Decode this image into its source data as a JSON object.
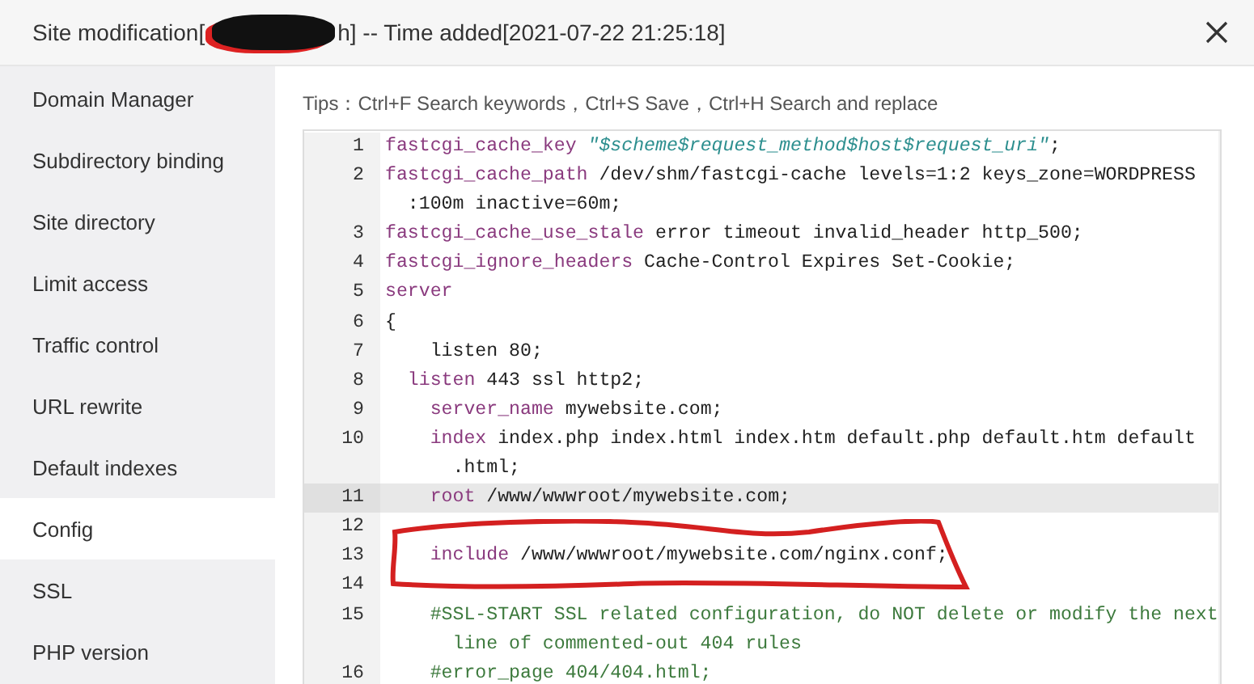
{
  "dialog": {
    "title_start": "Site modification[",
    "title_redacted": true,
    "title_end": "h] -- Time added[2021-07-22 21:25:18]"
  },
  "sidebar": {
    "items": [
      {
        "label": "Domain Manager",
        "selected": false
      },
      {
        "label": "Subdirectory binding",
        "selected": false
      },
      {
        "label": "Site directory",
        "selected": false
      },
      {
        "label": "Limit access",
        "selected": false
      },
      {
        "label": "Traffic control",
        "selected": false
      },
      {
        "label": "URL rewrite",
        "selected": false
      },
      {
        "label": "Default indexes",
        "selected": false
      },
      {
        "label": "Config",
        "selected": true
      },
      {
        "label": "SSL",
        "selected": false
      },
      {
        "label": "PHP version",
        "selected": false
      }
    ]
  },
  "tips": "Tips：Ctrl+F Search keywords，Ctrl+S Save，Ctrl+H Search and replace",
  "editor": {
    "lines": [
      {
        "number": "1",
        "active": false,
        "rows": [
          [
            {
              "kind": "keyword",
              "text": "fastcgi_cache_key"
            },
            {
              "kind": "plain",
              "text": " "
            },
            {
              "kind": "string",
              "text": "\"$scheme$request_method$host$request_uri\""
            },
            {
              "kind": "plain",
              "text": ";"
            }
          ]
        ]
      },
      {
        "number": "2",
        "active": false,
        "rows": [
          [
            {
              "kind": "keyword",
              "text": "fastcgi_cache_path"
            },
            {
              "kind": "plain",
              "text": " /dev/shm/fastcgi-cache levels=1:2 keys_zone=WORDPRESS"
            }
          ],
          [
            {
              "kind": "plain",
              "text": "  :100m inactive=60m;"
            }
          ]
        ]
      },
      {
        "number": "3",
        "active": false,
        "rows": [
          [
            {
              "kind": "keyword",
              "text": "fastcgi_cache_use_stale"
            },
            {
              "kind": "plain",
              "text": " error timeout invalid_header http_500;"
            }
          ]
        ]
      },
      {
        "number": "4",
        "active": false,
        "rows": [
          [
            {
              "kind": "keyword",
              "text": "fastcgi_ignore_headers"
            },
            {
              "kind": "plain",
              "text": " Cache-Control Expires Set-Cookie;"
            }
          ]
        ]
      },
      {
        "number": "5",
        "active": false,
        "rows": [
          [
            {
              "kind": "keyword",
              "text": "server"
            }
          ]
        ]
      },
      {
        "number": "6",
        "active": false,
        "rows": [
          [
            {
              "kind": "plain",
              "text": "{"
            }
          ]
        ]
      },
      {
        "number": "7",
        "active": false,
        "rows": [
          [
            {
              "kind": "plain",
              "text": "    listen 80;"
            }
          ]
        ]
      },
      {
        "number": "8",
        "active": false,
        "rows": [
          [
            {
              "kind": "keyword",
              "text": "  listen"
            },
            {
              "kind": "plain",
              "text": " 443 ssl http2;"
            }
          ]
        ]
      },
      {
        "number": "9",
        "active": false,
        "rows": [
          [
            {
              "kind": "keyword",
              "text": "    server_name"
            },
            {
              "kind": "plain",
              "text": " mywebsite.com;"
            }
          ]
        ]
      },
      {
        "number": "10",
        "active": false,
        "rows": [
          [
            {
              "kind": "keyword",
              "text": "    index"
            },
            {
              "kind": "plain",
              "text": " index.php index.html index.htm default.php default.htm default"
            }
          ],
          [
            {
              "kind": "plain",
              "text": "      .html;"
            }
          ]
        ]
      },
      {
        "number": "11",
        "active": true,
        "rows": [
          [
            {
              "kind": "keyword",
              "text": "    root"
            },
            {
              "kind": "plain",
              "text": " /www/wwwroot/mywebsite.com;"
            }
          ]
        ]
      },
      {
        "number": "12",
        "active": false,
        "rows": [
          [
            {
              "kind": "plain",
              "text": " "
            }
          ]
        ]
      },
      {
        "number": "13",
        "active": false,
        "rows": [
          [
            {
              "kind": "keyword",
              "text": "    include"
            },
            {
              "kind": "plain",
              "text": " /www/wwwroot/mywebsite.com/nginx.conf;"
            }
          ]
        ]
      },
      {
        "number": "14",
        "active": false,
        "rows": [
          [
            {
              "kind": "plain",
              "text": " "
            }
          ]
        ]
      },
      {
        "number": "15",
        "active": false,
        "rows": [
          [
            {
              "kind": "comment",
              "text": "    #SSL-START SSL related configuration, do NOT delete or modify the next"
            }
          ],
          [
            {
              "kind": "comment",
              "text": "      line of commented-out 404 rules"
            }
          ]
        ]
      },
      {
        "number": "16",
        "active": false,
        "rows": [
          [
            {
              "kind": "comment",
              "text": "    #error_page 404/404.html;"
            }
          ]
        ]
      }
    ]
  }
}
